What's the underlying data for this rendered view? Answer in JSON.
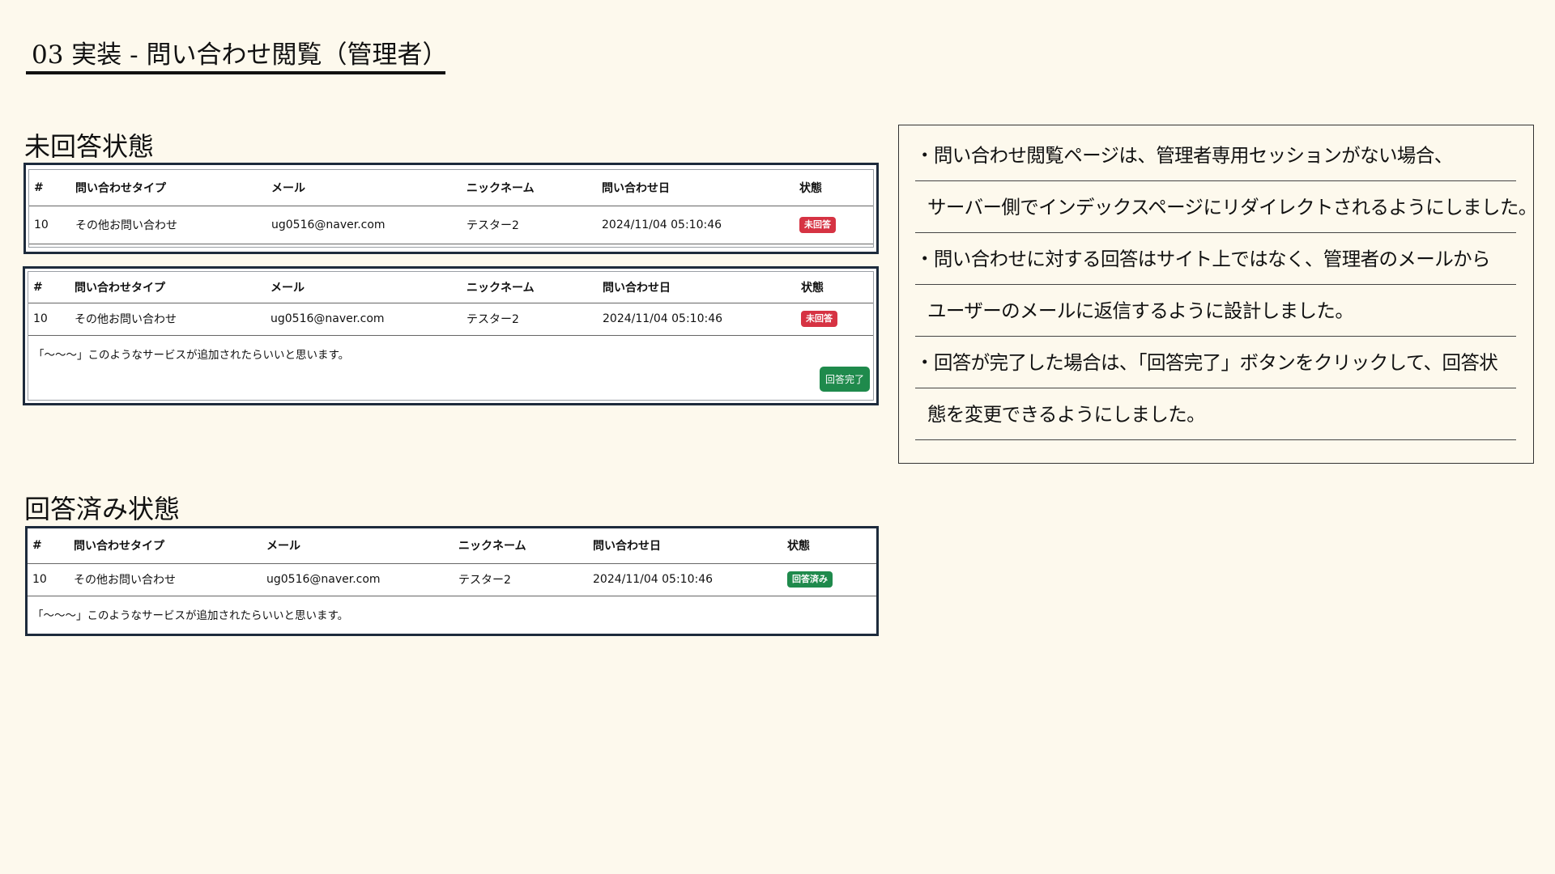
{
  "slide": {
    "title": "03 実装 - 問い合わせ閲覧（管理者）"
  },
  "sections": {
    "unanswered": {
      "heading": "未回答状態"
    },
    "answered": {
      "heading": "回答済み状態"
    }
  },
  "table": {
    "headers": [
      "#",
      "問い合わせタイプ",
      "メール",
      "ニックネーム",
      "問い合わせ日",
      "状態"
    ]
  },
  "tables": {
    "unanswered_collapsed": {
      "row": {
        "id": "10",
        "type": "その他お問い合わせ",
        "email": "ug0516@naver.com",
        "nickname": "テスター2",
        "date": "2024/11/04 05:10:46",
        "status": "未回答"
      }
    },
    "unanswered_expanded": {
      "row": {
        "id": "10",
        "type": "その他お問い合わせ",
        "email": "ug0516@naver.com",
        "nickname": "テスター2",
        "date": "2024/11/04 05:10:46",
        "status": "未回答"
      },
      "message": "「～～～」このようなサービスが追加されたらいいと思います。",
      "complete_button": "回答完了"
    },
    "answered_expanded": {
      "row": {
        "id": "10",
        "type": "その他お問い合わせ",
        "email": "ug0516@naver.com",
        "nickname": "テスター2",
        "date": "2024/11/04 05:10:46",
        "status": "回答済み"
      },
      "message": "「～～～」このようなサービスが追加されたらいいと思います。"
    }
  },
  "colors": {
    "background": "#fdf9ed",
    "frame_border": "#1d2b3c",
    "status_unanswered": "#d63343",
    "status_answered": "#1f8a4c"
  },
  "notes": [
    "・問い合わせ閲覧ページは、管理者専用セッションがない場合、",
    "サーバー側でインデックスページにリダイレクトされるようにしました。",
    "・問い合わせに対する回答はサイト上ではなく、管理者のメールから",
    "ユーザーのメールに返信するように設計しました。",
    "・回答が完了した場合は、「回答完了」ボタンをクリックして、回答状",
    "態を変更できるようにしました。"
  ]
}
